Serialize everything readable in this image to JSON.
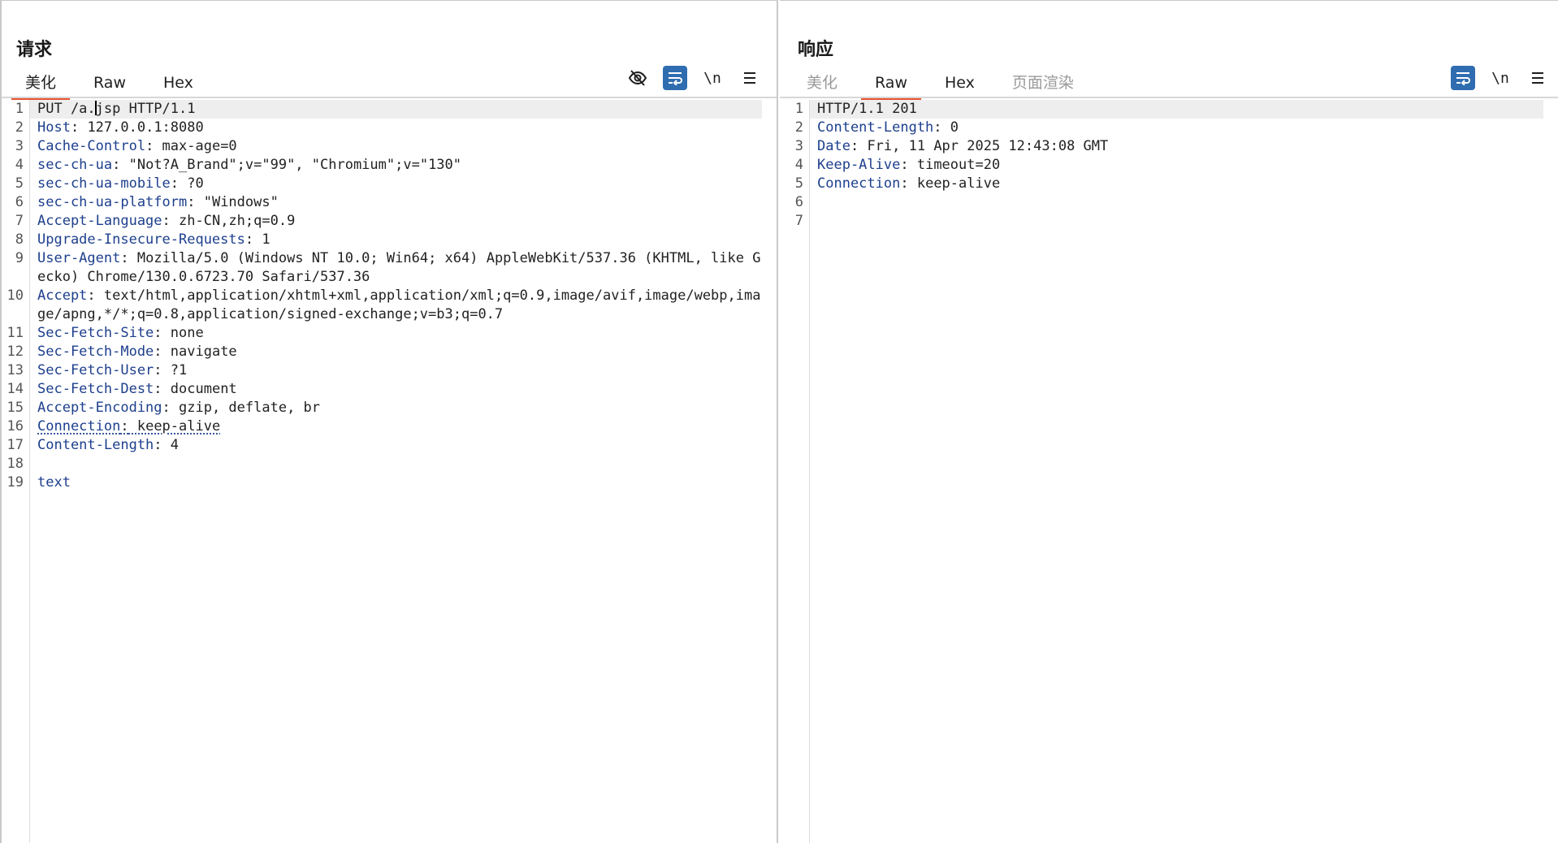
{
  "layout_toggle": {
    "active": "side-by-side",
    "buttons": [
      "side-by-side",
      "stacked",
      "single"
    ]
  },
  "request": {
    "title": "请求",
    "tabs": [
      {
        "label": "美化",
        "active": true
      },
      {
        "label": "Raw",
        "active": false
      },
      {
        "label": "Hex",
        "active": false
      }
    ],
    "tools": [
      {
        "icon": "eye-off-icon",
        "on": false
      },
      {
        "icon": "wrap-lines-icon",
        "on": true
      },
      {
        "icon": "newline-icon",
        "label": "\\n",
        "on": false
      },
      {
        "icon": "menu-icon",
        "on": false
      }
    ],
    "lines": [
      {
        "n": "1",
        "plain": "PUT /a.jsp HTTP/1.1",
        "caret_after": "PUT /a.",
        "current": true
      },
      {
        "n": "2",
        "key": "Host",
        "value": " 127.0.0.1:8080"
      },
      {
        "n": "3",
        "key": "Cache-Control",
        "value": " max-age=0"
      },
      {
        "n": "4",
        "key": "sec-ch-ua",
        "value": " \"Not?A_Brand\";v=\"99\", \"Chromium\";v=\"130\""
      },
      {
        "n": "5",
        "key": "sec-ch-ua-mobile",
        "value": " ?0"
      },
      {
        "n": "6",
        "key": "sec-ch-ua-platform",
        "value": " \"Windows\""
      },
      {
        "n": "7",
        "key": "Accept-Language",
        "value": " zh-CN,zh;q=0.9"
      },
      {
        "n": "8",
        "key": "Upgrade-Insecure-Requests",
        "value": " 1"
      },
      {
        "n": "9",
        "key": "User-Agent",
        "value": " Mozilla/5.0 (Windows NT 10.0; Win64; x64) AppleWebKit/537.36 (KHTML, like Gecko) Chrome/130.0.6723.70 Safari/537.36"
      },
      {
        "n": "10",
        "key": "Accept",
        "value": " text/html,application/xhtml+xml,application/xml;q=0.9,image/avif,image/webp,image/apng,*/*;q=0.8,application/signed-exchange;v=b3;q=0.7"
      },
      {
        "n": "11",
        "key": "Sec-Fetch-Site",
        "value": " none"
      },
      {
        "n": "12",
        "key": "Sec-Fetch-Mode",
        "value": " navigate"
      },
      {
        "n": "13",
        "key": "Sec-Fetch-User",
        "value": " ?1"
      },
      {
        "n": "14",
        "key": "Sec-Fetch-Dest",
        "value": " document"
      },
      {
        "n": "15",
        "key": "Accept-Encoding",
        "value": " gzip, deflate, br"
      },
      {
        "n": "16",
        "key": "Connection",
        "value": " keep-alive",
        "squiggle": true
      },
      {
        "n": "17",
        "key": "Content-Length",
        "value": " 4"
      },
      {
        "n": "18",
        "plain": ""
      },
      {
        "n": "19",
        "body": "text"
      }
    ]
  },
  "response": {
    "title": "响应",
    "tabs": [
      {
        "label": "美化",
        "active": false,
        "disabled": true
      },
      {
        "label": "Raw",
        "active": true
      },
      {
        "label": "Hex",
        "active": false
      },
      {
        "label": "页面渲染",
        "active": false,
        "disabled": true
      }
    ],
    "tools": [
      {
        "icon": "wrap-lines-icon",
        "on": true
      },
      {
        "icon": "newline-icon",
        "label": "\\n",
        "on": false
      },
      {
        "icon": "menu-icon",
        "on": false
      }
    ],
    "lines": [
      {
        "n": "1",
        "plain": "HTTP/1.1 201",
        "current": true
      },
      {
        "n": "2",
        "key": "Content-Length",
        "value": " 0"
      },
      {
        "n": "3",
        "key": "Date",
        "value": " Fri, 11 Apr 2025 12:43:08 GMT"
      },
      {
        "n": "4",
        "key": "Keep-Alive",
        "value": " timeout=20"
      },
      {
        "n": "5",
        "key": "Connection",
        "value": " keep-alive"
      },
      {
        "n": "6",
        "plain": ""
      },
      {
        "n": "7",
        "plain": ""
      }
    ]
  },
  "colors": {
    "accent": "#e8532e",
    "button_on": "#2f6db0",
    "header_key": "#1d3f8d"
  }
}
